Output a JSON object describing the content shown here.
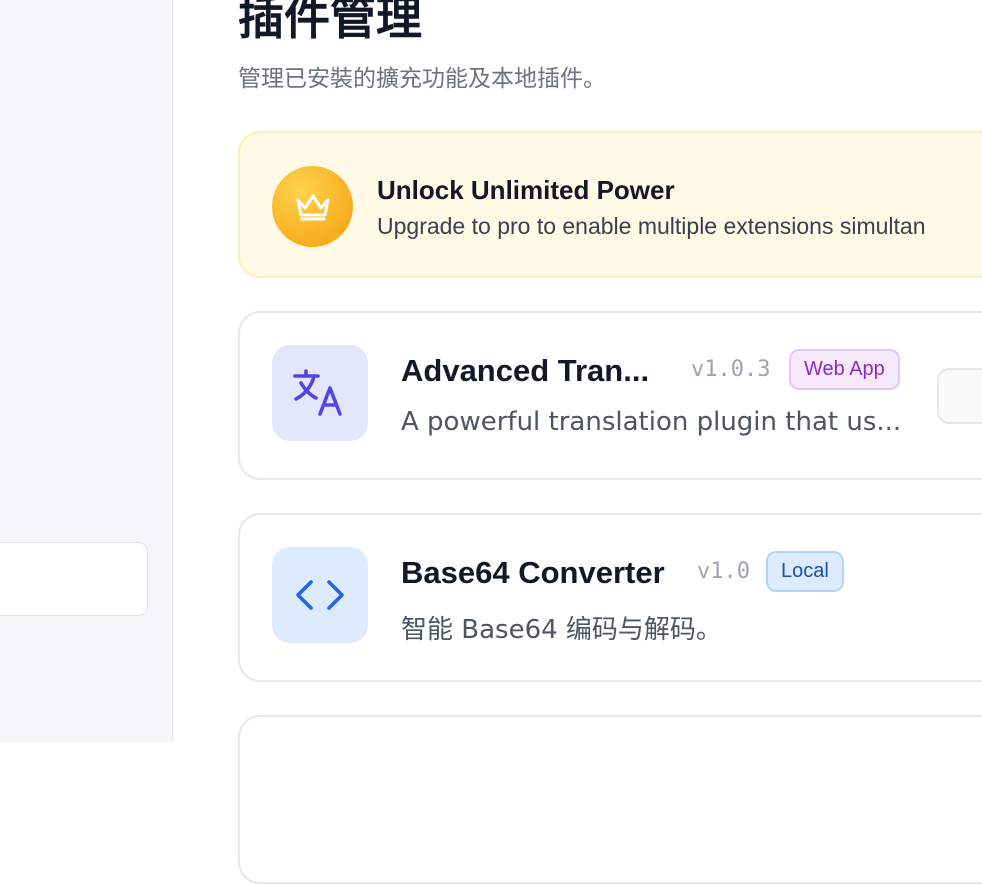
{
  "page": {
    "title": "插件管理",
    "subtitle": "管理已安裝的擴充功能及本地插件。"
  },
  "promo": {
    "title": "Unlock Unlimited Power",
    "description": "Upgrade to pro to enable multiple extensions simultan",
    "icon": "crown-icon"
  },
  "extensions": [
    {
      "name": "Advanced Tran...",
      "version": "v1.0.3",
      "tag": "Web App",
      "description": "A powerful translation plugin that us...",
      "icon": "translate-icon",
      "icon_bg": "#e4e7fb",
      "icon_color": "#4f46e5",
      "tag_bg": "#f6e9fc",
      "tag_border": "#e6c4f7",
      "tag_color": "#8e2bbf"
    },
    {
      "name": "Base64 Converter",
      "version": "v1.0",
      "tag": "Local",
      "description": "智能 Base64 编码与解码。",
      "icon": "code-icon",
      "icon_bg": "#dcebfd",
      "icon_color": "#2563eb",
      "tag_bg": "#dcebfd",
      "tag_border": "#b6d3f5",
      "tag_color": "#1e4fa8"
    }
  ],
  "colors": {
    "accent_gold": "#f59e0b",
    "promo_bg": "#fff9e6"
  }
}
